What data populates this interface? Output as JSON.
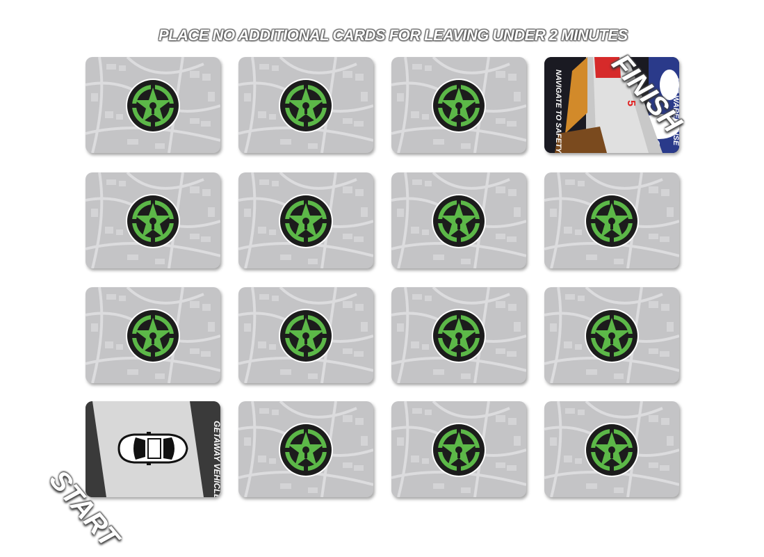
{
  "banner": {
    "text": "PLACE NO ADDITIONAL CARDS FOR LEAVING UNDER 2 MINUTES"
  },
  "labels": {
    "start": "START",
    "finish": "FINISH"
  },
  "start_card": {
    "title": "GETAWAY VEHICLE",
    "icon": "car-icon"
  },
  "finish_card": {
    "title": "THE WAREHOUSE",
    "subtitle": "NAVIGATE TO SAFETY",
    "number": "5",
    "icon": "warehouse-ramp-illustration"
  },
  "face_down_card": {
    "icon": "achievement-hunter-star-logo-icon",
    "back": "city-map-pattern"
  },
  "grid": {
    "rows": 4,
    "columns": 4
  },
  "colors": {
    "logo_green": "#5cb848",
    "logo_dark": "#1c1c1c",
    "card_gray": "#c4c4c6",
    "map_lines": "#dcdcde"
  }
}
